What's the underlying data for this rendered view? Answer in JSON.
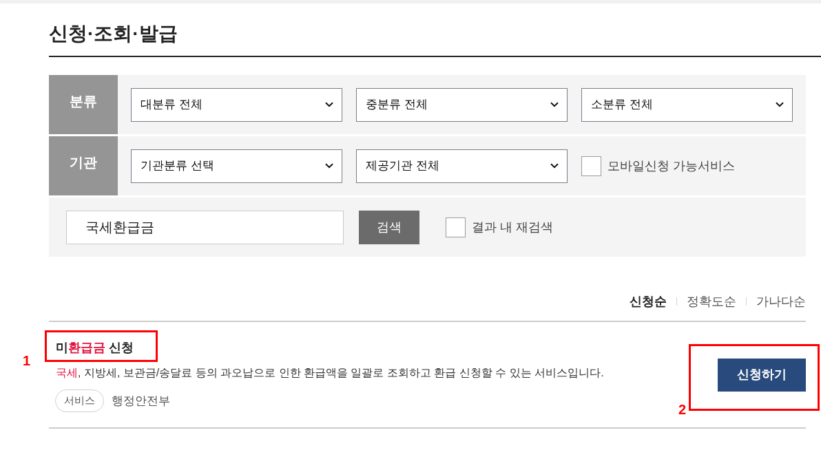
{
  "page_title": "신청·조회·발급",
  "filter_panel": {
    "rows": [
      {
        "label": "분류",
        "controls": [
          {
            "kind": "select",
            "value": "대분류 전체"
          },
          {
            "kind": "select",
            "value": "중분류 전체"
          },
          {
            "kind": "select",
            "value": "소분류 전체"
          }
        ]
      },
      {
        "label": "기관",
        "controls": [
          {
            "kind": "select",
            "value": "기관분류 선택"
          },
          {
            "kind": "select",
            "value": "제공기관 전체"
          },
          {
            "kind": "checkbox",
            "label": "모바일신청 가능서비스",
            "checked": false
          }
        ]
      }
    ],
    "search": {
      "value": "국세환급금",
      "button": "검색",
      "refine": {
        "label": "결과 내 재검색",
        "checked": false
      }
    }
  },
  "sort_options": [
    {
      "label": "신청순",
      "selected": true
    },
    {
      "label": "정확도순",
      "selected": false
    },
    {
      "label": "가나다순",
      "selected": false
    }
  ],
  "results": [
    {
      "title": [
        {
          "text": "미",
          "highlighted": false
        },
        {
          "text": "환급금",
          "highlighted": true
        },
        {
          "text": " 신청",
          "highlighted": false
        }
      ],
      "description": [
        {
          "text": "국세",
          "highlighted": true
        },
        {
          "text": ", 지방세, 보관금/송달료 등의 과오납으로 인한 환급액을 일괄로 조회하고 환급 신청할 수 있는 서비스입니다.",
          "highlighted": false
        }
      ],
      "tag": "서비스",
      "agency": "행정안전부",
      "button": "신청하기",
      "title_marker": "1",
      "button_marker": "2"
    }
  ]
}
